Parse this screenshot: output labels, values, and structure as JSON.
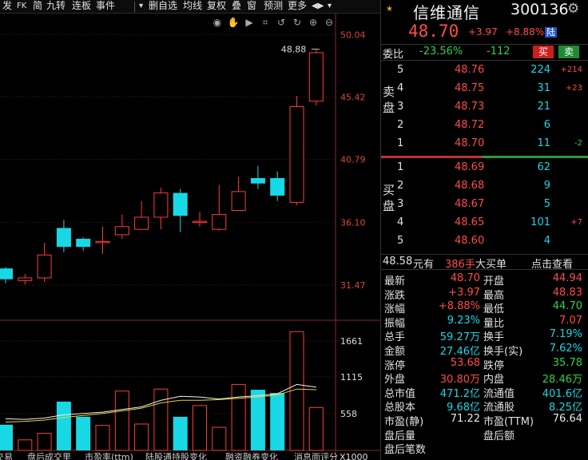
{
  "toolbar": {
    "items": [
      "发",
      "FK",
      "简",
      "九转",
      "连板",
      "事件",
      "▾",
      "删自选",
      "均线",
      "复权",
      "叠",
      "窗",
      "预测",
      "更多",
      "◀▶",
      "▾"
    ]
  },
  "chart_icons": [
    "eye-icon",
    "hand-icon",
    "play-icon",
    "crop-icon",
    "undo-icon",
    "redo-icon",
    "zoom-in-icon",
    "zoom-out-icon"
  ],
  "chart_data": [
    {
      "type": "candlestick",
      "y_ticks": [
        "50.04",
        "45.42",
        "40.79",
        "36.10",
        "31.47"
      ],
      "ylim": [
        28.8,
        51.6
      ],
      "annotation": "48.88",
      "candles": [
        {
          "open": 32.7,
          "close": 31.9,
          "high": 32.8,
          "low": 31.6
        },
        {
          "open": 31.8,
          "close": 32.0,
          "high": 32.3,
          "low": 31.5
        },
        {
          "open": 32.0,
          "close": 33.7,
          "high": 34.6,
          "low": 31.7
        },
        {
          "open": 35.7,
          "close": 34.3,
          "high": 36.3,
          "low": 33.9
        },
        {
          "open": 34.9,
          "close": 34.3,
          "high": 35.0,
          "low": 34.0
        },
        {
          "open": 34.7,
          "close": 34.7,
          "high": 35.8,
          "low": 33.8
        },
        {
          "open": 35.2,
          "close": 35.8,
          "high": 36.7,
          "low": 34.9
        },
        {
          "open": 35.6,
          "close": 36.5,
          "high": 37.7,
          "low": 35.6
        },
        {
          "open": 36.5,
          "close": 38.3,
          "high": 38.7,
          "low": 35.6
        },
        {
          "open": 38.3,
          "close": 36.6,
          "high": 38.6,
          "low": 35.4
        },
        {
          "open": 36.2,
          "close": 36.2,
          "high": 36.9,
          "low": 35.8
        },
        {
          "open": 35.6,
          "close": 36.7,
          "high": 38.9,
          "low": 35.5
        },
        {
          "open": 37.0,
          "close": 38.4,
          "high": 39.5,
          "low": 37.0
        },
        {
          "open": 39.4,
          "close": 39.0,
          "high": 40.3,
          "low": 38.6
        },
        {
          "open": 39.4,
          "close": 38.1,
          "high": 39.9,
          "low": 37.7
        },
        {
          "open": 37.6,
          "close": 44.7,
          "high": 45.5,
          "low": 37.4
        },
        {
          "open": 45.1,
          "close": 48.7,
          "high": 48.9,
          "low": 44.8
        }
      ]
    },
    {
      "type": "bar",
      "y_ticks": [
        "1661",
        "1115",
        "558"
      ],
      "unit_label": "X1000",
      "ylim": [
        0,
        1780
      ],
      "volumes": [
        390,
        160,
        260,
        740,
        510,
        380,
        900,
        400,
        930,
        510,
        680,
        350,
        1000,
        920,
        870,
        1800,
        650
      ],
      "ma_short": [
        480,
        470,
        490,
        540,
        560,
        580,
        620,
        660,
        760,
        820,
        810,
        780,
        810,
        830,
        860,
        1000,
        960
      ],
      "ma_long": [
        430,
        440,
        460,
        500,
        530,
        560,
        600,
        640,
        720,
        760,
        760,
        770,
        790,
        810,
        840,
        930,
        920
      ]
    }
  ],
  "bottom_tabs": [
    "交易",
    "盘后成交里",
    "市盈率(ttm)",
    "陆股通持股变化",
    "融资融券变化",
    "消息面评分"
  ],
  "quote": {
    "name": "信维通信",
    "code": "300136",
    "price": "48.70",
    "change": "+3.97",
    "pct": "+8.88%",
    "badge": "陆"
  },
  "weibi": {
    "label": "委比",
    "pct": "-23.56%",
    "diff": "-112",
    "buy": "买",
    "sell": "卖"
  },
  "order_book": {
    "sell_label": "卖盘",
    "buy_label": "买盘",
    "asks": [
      {
        "level": "5",
        "price": "48.76",
        "vol": "224",
        "chg": "+214",
        "chg_color": "red"
      },
      {
        "level": "4",
        "price": "48.75",
        "vol": "31",
        "chg": "+23",
        "chg_color": "red"
      },
      {
        "level": "3",
        "price": "48.73",
        "vol": "21",
        "chg": "",
        "chg_color": "red"
      },
      {
        "level": "2",
        "price": "48.72",
        "vol": "6",
        "chg": "",
        "chg_color": "red"
      },
      {
        "level": "1",
        "price": "48.70",
        "vol": "11",
        "chg": "-2",
        "chg_color": "green"
      }
    ],
    "bids": [
      {
        "level": "1",
        "price": "48.69",
        "vol": "62",
        "chg": "",
        "chg_color": "red"
      },
      {
        "level": "2",
        "price": "48.68",
        "vol": "9",
        "chg": "",
        "chg_color": "red"
      },
      {
        "level": "3",
        "price": "48.67",
        "vol": "5",
        "chg": "",
        "chg_color": "red"
      },
      {
        "level": "4",
        "price": "48.65",
        "vol": "101",
        "chg": "+7",
        "chg_color": "red"
      },
      {
        "level": "5",
        "price": "48.60",
        "vol": "4",
        "chg": "",
        "chg_color": "red"
      }
    ]
  },
  "summary": {
    "price": "48.58",
    "have": "元有",
    "lots": "386手",
    "big": "大买单",
    "link": "点击查看"
  },
  "stats": [
    {
      "l1": "最新",
      "v1": "48.70",
      "c1": "red",
      "l2": "开盘",
      "v2": "44.94",
      "c2": "red"
    },
    {
      "l1": "涨跌",
      "v1": "+3.97",
      "c1": "red",
      "l2": "最高",
      "v2": "48.83",
      "c2": "red"
    },
    {
      "l1": "涨幅",
      "v1": "+8.88%",
      "c1": "red",
      "l2": "最低",
      "v2": "44.70",
      "c2": "green"
    },
    {
      "l1": "振幅",
      "v1": "9.23%",
      "c1": "cyan",
      "l2": "量比",
      "v2": "7.07",
      "c2": "red"
    },
    {
      "l1": "总手",
      "v1": "59.27万",
      "c1": "cyan",
      "l2": "换手",
      "v2": "7.19%",
      "c2": "cyan"
    },
    {
      "l1": "金额",
      "v1": "27.46亿",
      "c1": "cyan",
      "l2": "换手(实)",
      "v2": "7.62%",
      "c2": "cyan"
    },
    {
      "l1": "涨停",
      "v1": "53.68",
      "c1": "red",
      "l2": "跌停",
      "v2": "35.78",
      "c2": "green"
    },
    {
      "l1": "外盘",
      "v1": "30.80万",
      "c1": "red",
      "l2": "内盘",
      "v2": "28.46万",
      "c2": "green"
    },
    {
      "l1": "总市值",
      "v1": "471.2亿",
      "c1": "cyan",
      "l2": "流通值",
      "v2": "401.6亿",
      "c2": "cyan"
    },
    {
      "l1": "总股本",
      "v1": "9.68亿",
      "c1": "cyan",
      "l2": "流通股",
      "v2": "8.25亿",
      "c2": "cyan"
    },
    {
      "l1": "市盈(静)",
      "v1": "71.22",
      "c1": "white",
      "l2": "市盈(TTM)",
      "v2": "76.64",
      "c2": "white"
    },
    {
      "l1": "盘后量",
      "v1": "",
      "c1": "white",
      "l2": "盘后额",
      "v2": "",
      "c2": "white"
    },
    {
      "l1": "盘后笔数",
      "v1": "",
      "c1": "white",
      "l2": "",
      "v2": "",
      "c2": "white"
    }
  ],
  "colors": {
    "up": "#ff3b3b",
    "down": "#19d8e6",
    "ma_short": "#f2f2f2",
    "ma_long": "#e8d23a"
  }
}
